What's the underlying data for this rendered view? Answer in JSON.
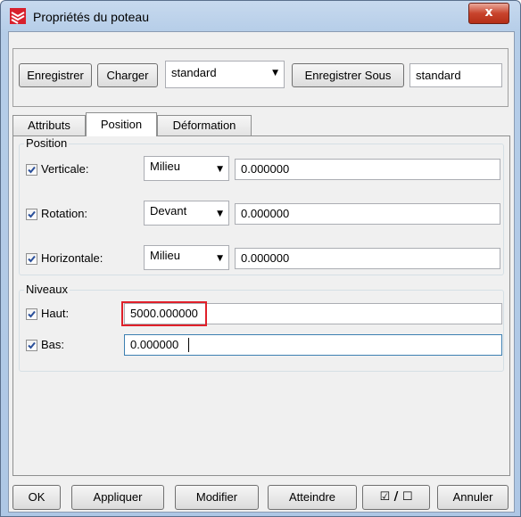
{
  "window": {
    "title": "Propriétés du poteau",
    "close_label": "x"
  },
  "toolbar": {
    "save_label": "Enregistrer",
    "load_label": "Charger",
    "preset_value": "standard",
    "save_as_label": "Enregistrer Sous",
    "save_as_value": "standard"
  },
  "tabs": [
    {
      "label": "Attributs",
      "active": false
    },
    {
      "label": "Position",
      "active": true
    },
    {
      "label": "Déformation",
      "active": false
    }
  ],
  "position_group": {
    "title": "Position",
    "rows": [
      {
        "label": "Verticale:",
        "checked": true,
        "option": "Milieu",
        "value": "0.000000"
      },
      {
        "label": "Rotation:",
        "checked": true,
        "option": "Devant",
        "value": "0.000000"
      },
      {
        "label": "Horizontale:",
        "checked": true,
        "option": "Milieu",
        "value": "0.000000"
      }
    ]
  },
  "levels_group": {
    "title": "Niveaux",
    "rows": [
      {
        "label": "Haut:",
        "checked": true,
        "value": "5000.000000",
        "highlighted": true
      },
      {
        "label": "Bas:",
        "checked": true,
        "value": "0.000000",
        "focused": true
      }
    ]
  },
  "buttons": {
    "ok": "OK",
    "apply": "Appliquer",
    "modify": "Modifier",
    "reach": "Atteindre",
    "toggle": "☑ / ☐",
    "cancel": "Annuler"
  },
  "colors": {
    "highlight_border": "#e0202a",
    "title_bar": "#b5cde8"
  }
}
